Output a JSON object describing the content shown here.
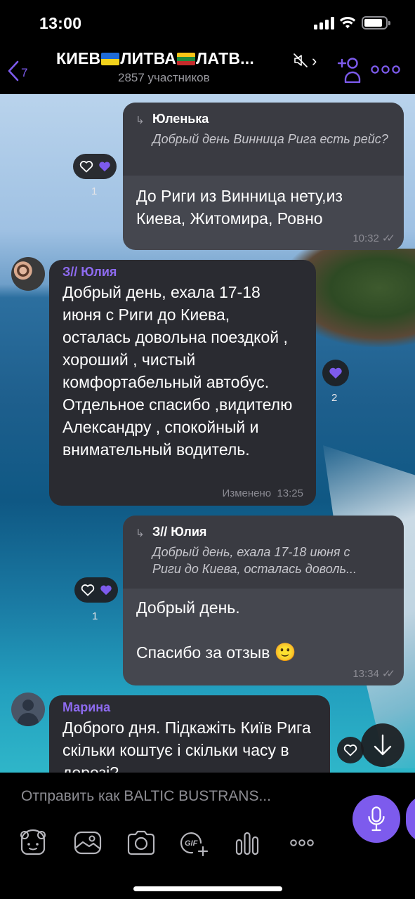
{
  "status_bar": {
    "time": "13:00"
  },
  "header": {
    "back_count": "7",
    "title_part1": "КИЕВ",
    "title_part2": "ЛИТВА",
    "title_part3": "ЛАТВ...",
    "subtitle": "2857 участников"
  },
  "messages": [
    {
      "reply_name": "Юленька",
      "reply_text": "Добрый день Винница Рига есть рейс?",
      "text_line1": "До Риги из Винница нету,из",
      "text_line2": "Киева, Житомира, Ровно",
      "time": "10:32",
      "reaction_count": "1"
    },
    {
      "sender": "З// Юлия",
      "text": "Добрый день, ехала 17-18 июня с Риги до Киева, осталась довольна поездкой , хороший , чистый комфортабельный автобус. Отдельное спасибо ,видителю Александру , спокойный и внимательный водитель.",
      "edited": "Изменено",
      "time": "13:25",
      "reaction_count": "2"
    },
    {
      "reply_name": "З// Юлия",
      "reply_text_line1": "Добрый день, ехала 17-18 июня с",
      "reply_text_line2": "Риги до Киева, осталась доволь...",
      "text_line1": "Добрый день.",
      "text_line2": "Спасибо за отзыв",
      "emoji": "🙂",
      "time": "13:34",
      "reaction_count": "1"
    },
    {
      "sender": "Марина",
      "text": "Доброго дня.  Підкажіть Київ Рига скільки коштує і скільки часу в дорозі?"
    }
  ],
  "composer": {
    "placeholder": "Отправить как BALTIC BUSTRANS..."
  },
  "colors": {
    "accent": "#7d5bed",
    "bubble_incoming": "#2a2b31",
    "bubble_outgoing": "#45474f"
  },
  "icons": [
    "back-icon",
    "mute-icon",
    "chevron-right-icon",
    "add-member-icon",
    "more-icon",
    "heart-icon",
    "scroll-down-icon",
    "sticker-icon",
    "gallery-icon",
    "camera-icon",
    "gif-icon",
    "poll-icon",
    "more-tools-icon",
    "microphone-icon"
  ]
}
